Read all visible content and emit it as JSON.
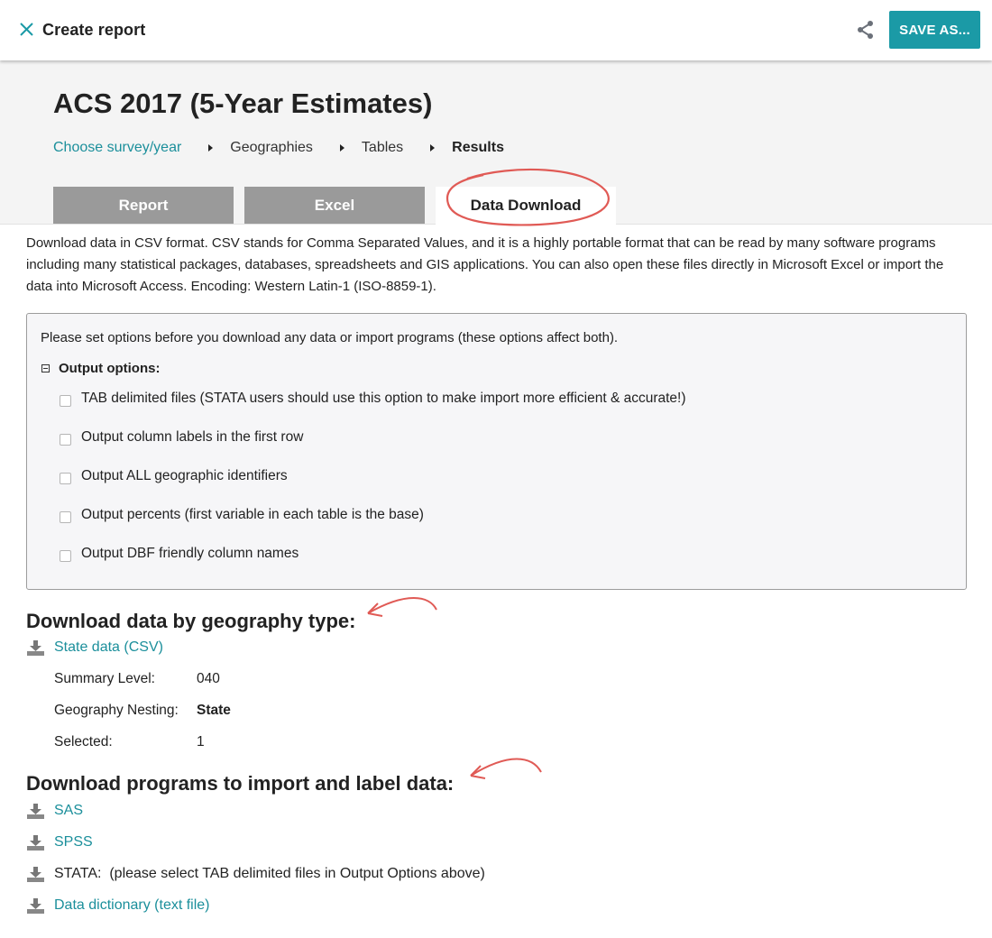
{
  "topbar": {
    "title": "Create report",
    "close_icon": "close-x-icon",
    "share_icon": "share-icon",
    "save_label": "SAVE AS..."
  },
  "header": {
    "title": "ACS 2017 (5-Year Estimates)",
    "breadcrumb": [
      {
        "label": "Choose survey/year",
        "link": true
      },
      {
        "label": "Geographies",
        "link": false
      },
      {
        "label": "Tables",
        "link": false
      },
      {
        "label": "Results",
        "current": true
      }
    ],
    "tabs": [
      {
        "label": "Report",
        "active": false
      },
      {
        "label": "Excel",
        "active": false
      },
      {
        "label": "Data Download",
        "active": true
      }
    ]
  },
  "intro": "Download data in CSV format. CSV stands for Comma Separated Values, and it is a highly portable format that can be read by many software programs including many statistical packages, databases, spreadsheets and GIS applications. You can also open these files directly in Microsoft Excel or import the data into Microsoft Access. Encoding: Western Latin-1 (ISO-8859-1).",
  "options": {
    "note": "Please set options before you download any data or import programs (these options affect both).",
    "heading": "Output options:",
    "items": [
      {
        "label": "TAB delimited files (STATA users should use this option to make import more efficient & accurate!)",
        "checked": false
      },
      {
        "label": "Output column labels in the first row",
        "checked": false
      },
      {
        "label": "Output ALL geographic identifiers",
        "checked": false
      },
      {
        "label": "Output percents (first variable in each table is the base)",
        "checked": false
      },
      {
        "label": "Output DBF friendly column names",
        "checked": false
      }
    ]
  },
  "geography": {
    "heading": "Download data by geography type:",
    "link": "State data (CSV)",
    "meta": [
      {
        "label": "Summary Level:",
        "value": "040"
      },
      {
        "label": "Geography Nesting:",
        "value": "State"
      },
      {
        "label": "Selected:",
        "value": "1"
      }
    ]
  },
  "programs": {
    "heading": "Download programs to import and label data:",
    "items": [
      {
        "label": "SAS",
        "link": true
      },
      {
        "label": "SPSS",
        "link": true
      },
      {
        "label": "STATA:  (please select TAB delimited files in Output Options above)",
        "link": false
      },
      {
        "label": "Data dictionary (text file)",
        "link": true
      }
    ]
  },
  "colors": {
    "accent": "#1b9aa6",
    "link": "#1b8f9b",
    "tab_inactive": "#9a9a9a",
    "annotation": "#e05a55"
  }
}
